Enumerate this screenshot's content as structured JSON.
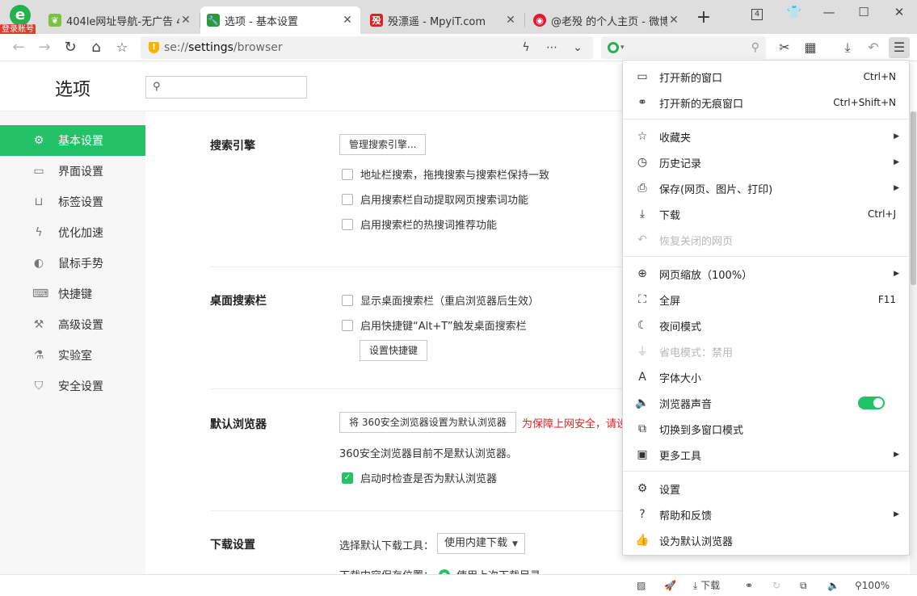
{
  "browser": {
    "account_badge": "登录账号",
    "tabs": [
      {
        "title": "404le网址导航-无广告 404",
        "favicon": "leaf-icon"
      },
      {
        "title": "选项 - 基本设置",
        "favicon": "wrench-icon"
      },
      {
        "title": "殁漂遥 - MpyiT.com",
        "favicon": "mpyit-icon"
      },
      {
        "title": "@老殁 的个人主页 - 微博",
        "favicon": "weibo-icon"
      }
    ],
    "tab_count": "4",
    "address": {
      "prefix": "se://",
      "host": "settings",
      "path": "/browser"
    }
  },
  "settings": {
    "page_title": "选项",
    "search_placeholder": "",
    "sidebar": [
      {
        "label": "基本设置",
        "icon": "gear-icon"
      },
      {
        "label": "界面设置",
        "icon": "window-icon"
      },
      {
        "label": "标签设置",
        "icon": "tab-icon"
      },
      {
        "label": "优化加速",
        "icon": "bolt-icon"
      },
      {
        "label": "鼠标手势",
        "icon": "mouse-icon"
      },
      {
        "label": "快捷键",
        "icon": "keyboard-icon"
      },
      {
        "label": "高级设置",
        "icon": "wrench-icon"
      },
      {
        "label": "实验室",
        "icon": "flask-icon"
      },
      {
        "label": "安全设置",
        "icon": "shield-icon"
      }
    ],
    "search_engine": {
      "title": "搜索引擎",
      "manage_button": "管理搜索引擎...",
      "options": [
        "地址栏搜索，拖拽搜索与搜索栏保持一致",
        "启用搜索栏自动提取网页搜索词功能",
        "启用搜索栏的热搜词推荐功能"
      ]
    },
    "desktop_search": {
      "title": "桌面搜索栏",
      "options": [
        "显示桌面搜索栏（重启浏览器后生效）",
        "启用快捷键“Alt+T”触发桌面搜索栏"
      ],
      "shortcut_button": "设置快捷键"
    },
    "default_browser": {
      "title": "默认浏览器",
      "set_button": "将 360安全浏览器设置为默认浏览器",
      "warning": "为保障上网安全，请设",
      "status": "360安全浏览器目前不是默认浏览器。",
      "check_option": "启动时检查是否为默认浏览器"
    },
    "download": {
      "title": "下载设置",
      "tool_label": "选择默认下载工具：",
      "tool_value": "使用内建下载",
      "location_label": "下载内容保存位置：",
      "location_option": "使用上次下载目录"
    }
  },
  "statusbar": {
    "download": "下载",
    "zoom": "100%"
  },
  "menu": {
    "items": [
      {
        "label": "打开新的窗口",
        "shortcut": "Ctrl+N",
        "icon": "new-window-icon"
      },
      {
        "label": "打开新的无痕窗口",
        "shortcut": "Ctrl+Shift+N",
        "icon": "incognito-mask-icon"
      },
      {
        "label": "收藏夹",
        "shortcut": "",
        "icon": "star-list-icon"
      },
      {
        "label": "历史记录",
        "shortcut": "",
        "icon": "clock-icon"
      },
      {
        "label": "保存(网页、图片、打印)",
        "shortcut": "",
        "icon": "save-icon"
      },
      {
        "label": "下载",
        "shortcut": "Ctrl+J",
        "icon": "download-icon"
      },
      {
        "label": "恢复关闭的网页",
        "shortcut": "",
        "icon": "undo-icon"
      },
      {
        "label": "网页缩放（100%）",
        "shortcut": "",
        "icon": "zoom-icon"
      },
      {
        "label": "全屏",
        "shortcut": "F11",
        "icon": "fullscreen-icon"
      },
      {
        "label": "夜间模式",
        "shortcut": "",
        "icon": "moon-icon"
      },
      {
        "label": "省电模式：禁用",
        "shortcut": "",
        "icon": "plug-icon"
      },
      {
        "label": "字体大小",
        "shortcut": "",
        "icon": "font-size-icon"
      },
      {
        "label": "浏览器声音",
        "shortcut": "",
        "icon": "speaker-icon"
      },
      {
        "label": "切换到多窗口模式",
        "shortcut": "",
        "icon": "multi-window-icon"
      },
      {
        "label": "更多工具",
        "shortcut": "",
        "icon": "toolbox-icon"
      },
      {
        "label": "设置",
        "shortcut": "",
        "icon": "gear-icon"
      },
      {
        "label": "帮助和反馈",
        "shortcut": "",
        "icon": "help-icon"
      },
      {
        "label": "设为默认浏览器",
        "shortcut": "",
        "icon": "thumbs-up-icon"
      }
    ]
  },
  "colors": {
    "accent": "#23c266",
    "warning": "#e02020",
    "tabstrip": "#dedede"
  }
}
